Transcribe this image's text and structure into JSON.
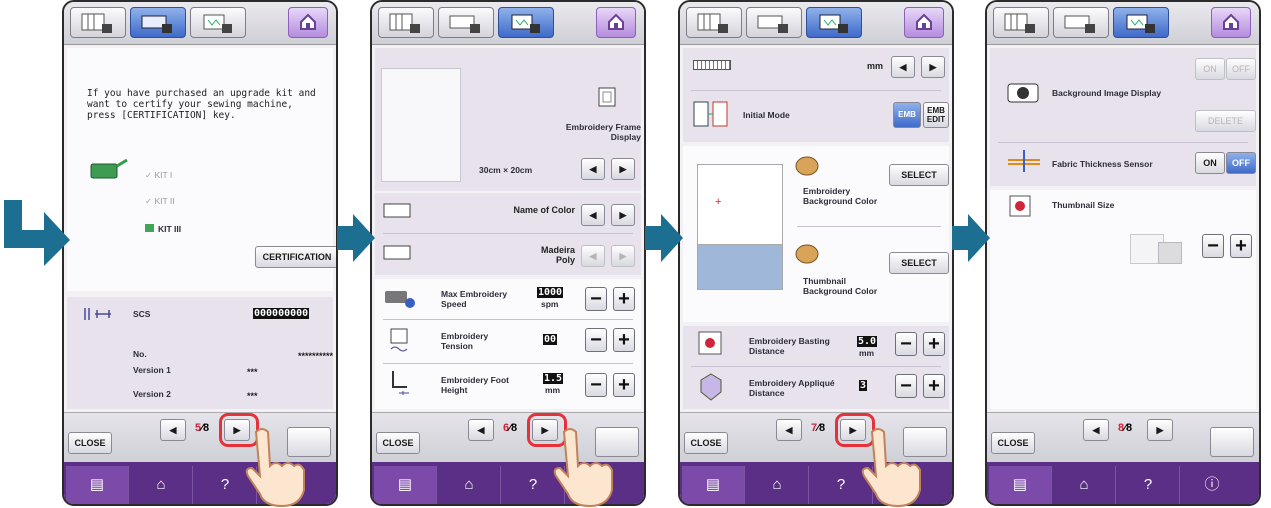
{
  "colors": {
    "accent": "#5c2f86",
    "page_red": "#d0243a",
    "flow_arrow": "#1c6f91"
  },
  "common": {
    "close_label": "CLOSE",
    "page_total": "8",
    "nav_help": "?"
  },
  "p1": {
    "message": "If you have purchased an upgrade kit and want to certify your sewing machine, press [CERTIFICATION] key.",
    "kit1": "KIT I",
    "kit2": "KIT II",
    "kit3": "KIT III",
    "cert_button": "CERTIFICATION",
    "scs_label": "SCS",
    "scs_value": "000000000",
    "no_label": "No.",
    "no_value": "**********",
    "v1_label": "Version 1",
    "v1_value": "***",
    "v2_label": "Version 2",
    "v2_value": "***",
    "page": "5"
  },
  "p2": {
    "frame_label": "Embroidery Frame Display",
    "frame_size_w": "30cm",
    "frame_x": "×",
    "frame_size_h": "20cm",
    "color_name": "Name of Color",
    "thread": "Madeira Poly",
    "speed_label": "Max Embroidery Speed",
    "speed_value": "1000",
    "speed_unit": "spm",
    "tension_label": "Embroidery Tension",
    "tension_value": "00",
    "foot_label": "Embroidery Foot Height",
    "foot_value": "1.5",
    "foot_unit": "mm",
    "page": "6"
  },
  "p3": {
    "unit": "mm",
    "initial_mode": "Initial Mode",
    "emb": "EMB",
    "emb_edit": "EMB EDIT",
    "bg_color": "Embroidery Background Color",
    "select": "SELECT",
    "thumb_color": "Thumbnail Background Color",
    "basting_label": "Embroidery Basting Distance",
    "basting_value": "5.0",
    "basting_unit": "mm",
    "applique_label": "Embroidery Appliqué Distance",
    "applique_value": "3",
    "page": "7"
  },
  "p4": {
    "bg_image": "Background Image Display",
    "on": "ON",
    "off": "OFF",
    "delete": "DELETE",
    "fabric": "Fabric Thickness Sensor",
    "thumb_size": "Thumbnail Size",
    "page": "8"
  }
}
